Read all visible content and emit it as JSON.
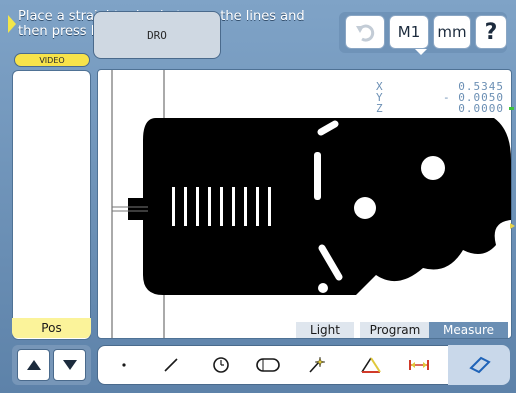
{
  "prompt": {
    "line1": "Place a straight edge between the lines and",
    "line2": "then press Enter"
  },
  "top_buttons": {
    "m1_label": "M1",
    "units_label": "mm",
    "help_label": "?"
  },
  "mode_tabs": {
    "video_label": "VIDEO",
    "dro_label": "DRO"
  },
  "left_panel": {
    "pos_label": "Pos"
  },
  "dro": {
    "x_axis": "X",
    "x_value": "0.5345",
    "y_axis": "Y",
    "y_value": "- 0.0050",
    "z_axis": "Z",
    "z_value": "0.0000"
  },
  "bottom_tabs": {
    "light": "Light",
    "program": "Program",
    "measure": "Measure"
  },
  "toolbar": {
    "tools": [
      "point-tool",
      "line-tool",
      "circle-tool",
      "slot-tool",
      "auto-measure-tool",
      "angle-tool",
      "distance-tool",
      "rectangle-tool"
    ]
  },
  "colors": {
    "accent_yellow": "#f7e34a",
    "frame_blue": "#6b8fb4",
    "part_black": "#000000"
  }
}
